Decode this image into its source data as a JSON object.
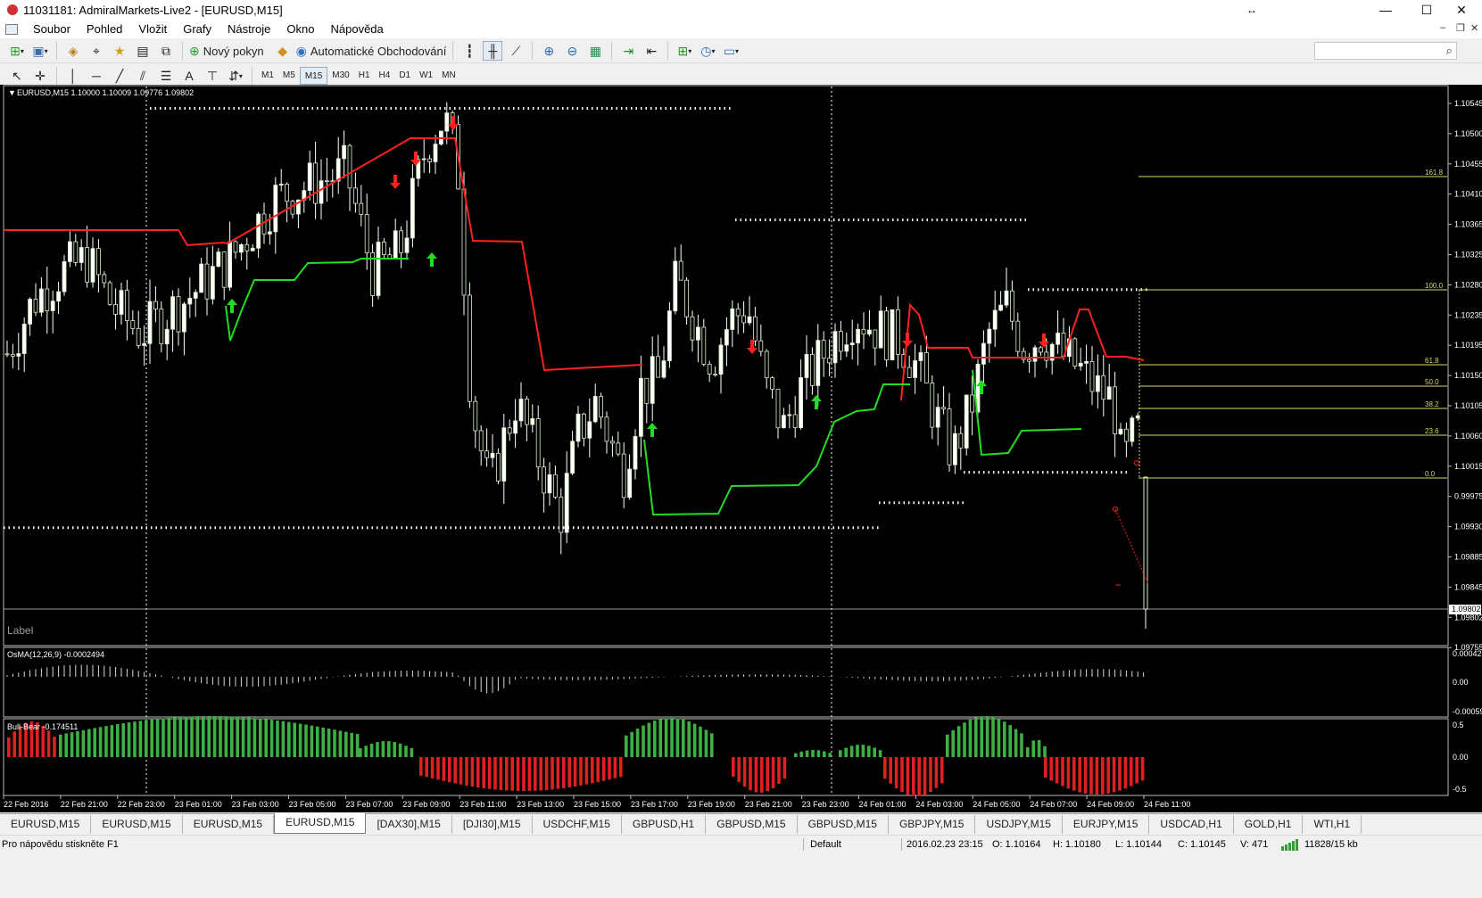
{
  "window": {
    "title": "11031181: AdmiralMarkets-Live2 - [EURUSD,M15]",
    "resize_glyph": "↔"
  },
  "menu": [
    "Soubor",
    "Pohled",
    "Vložit",
    "Grafy",
    "Nástroje",
    "Okno",
    "Nápověda"
  ],
  "toolbar1": {
    "new_order": "Nový pokyn",
    "auto_trading": "Automatické Obchodování"
  },
  "toolbar2": {
    "timeframes": [
      "M1",
      "M5",
      "M15",
      "M30",
      "H1",
      "H4",
      "D1",
      "W1",
      "MN"
    ],
    "active_timeframe": "M15"
  },
  "chart": {
    "header": "EURUSD,M15  1.10000 1.10009 1.09776 1.09802",
    "label_text": "Label",
    "price_axis": [
      "1.10545",
      "1.10500",
      "1.10455",
      "1.10410",
      "1.10365",
      "1.10325",
      "1.10280",
      "1.10235",
      "1.10195",
      "1.10150",
      "1.10105",
      "1.10060",
      "1.10015",
      "0.99975",
      "1.09930",
      "1.09885",
      "1.09845",
      "1.09802",
      "1.09755"
    ],
    "current_price": "1.09802",
    "fibo_levels": [
      "161.8",
      "100.0",
      "61.8",
      "50.0",
      "38.2",
      "23.6",
      "0.0"
    ],
    "time_axis": [
      "22 Feb 2016",
      "22 Feb 21:00",
      "22 Feb 23:00",
      "23 Feb 01:00",
      "23 Feb 03:00",
      "23 Feb 05:00",
      "23 Feb 07:00",
      "23 Feb 09:00",
      "23 Feb 11:00",
      "23 Feb 13:00",
      "23 Feb 15:00",
      "23 Feb 17:00",
      "23 Feb 19:00",
      "23 Feb 21:00",
      "23 Feb 23:00",
      "24 Feb 01:00",
      "24 Feb 03:00",
      "24 Feb 05:00",
      "24 Feb 07:00",
      "24 Feb 09:00",
      "24 Feb 11:00"
    ],
    "osma": {
      "label": "OsMA(12,26,9) -0.0002494",
      "axis": [
        "0.000423",
        "0.00",
        "-0.000593"
      ]
    },
    "bullbear": {
      "label": "Bull-Bear -0.174511",
      "axis": [
        "0.5",
        "0.00",
        "-0.5"
      ]
    },
    "colors": {
      "bull": "#3cb043",
      "bear": "#e02020",
      "fibo": "#d8d86a",
      "trend_up": "#22dd22",
      "trend_down": "#ff2020"
    }
  },
  "tabs": [
    "EURUSD,M15",
    "EURUSD,M15",
    "EURUSD,M15",
    "EURUSD,M15",
    "[DAX30],M15",
    "[DJI30],M15",
    "USDCHF,M15",
    "GBPUSD,H1",
    "GBPUSD,M15",
    "GBPUSD,M15",
    "GBPJPY,M15",
    "USDJPY,M15",
    "EURJPY,M15",
    "USDCAD,H1",
    "GOLD,H1",
    "WTI,H1"
  ],
  "active_tab": 3,
  "status": {
    "help": "Pro nápovědu stiskněte F1",
    "profile": "Default",
    "datetime": "2016.02.23 23:15",
    "open": "O: 1.10164",
    "high": "H: 1.10180",
    "low": "L: 1.10144",
    "close": "C: 1.10145",
    "volume": "V: 471",
    "traffic": "11828/15 kb"
  }
}
